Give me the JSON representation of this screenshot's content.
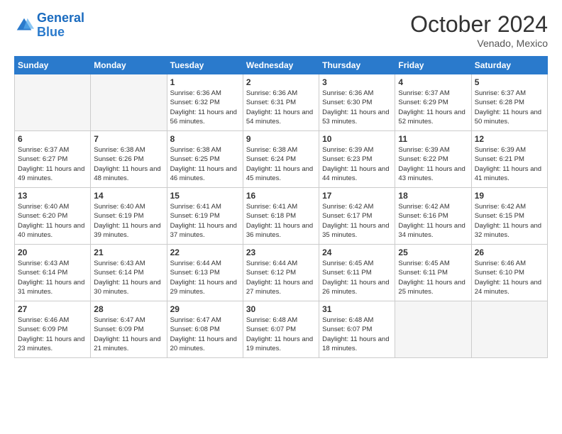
{
  "logo": {
    "line1": "General",
    "line2": "Blue"
  },
  "title": "October 2024",
  "location": "Venado, Mexico",
  "days_of_week": [
    "Sunday",
    "Monday",
    "Tuesday",
    "Wednesday",
    "Thursday",
    "Friday",
    "Saturday"
  ],
  "weeks": [
    [
      {
        "num": "",
        "sunrise": "",
        "sunset": "",
        "daylight": "",
        "empty": true
      },
      {
        "num": "",
        "sunrise": "",
        "sunset": "",
        "daylight": "",
        "empty": true
      },
      {
        "num": "1",
        "sunrise": "Sunrise: 6:36 AM",
        "sunset": "Sunset: 6:32 PM",
        "daylight": "Daylight: 11 hours and 56 minutes.",
        "empty": false
      },
      {
        "num": "2",
        "sunrise": "Sunrise: 6:36 AM",
        "sunset": "Sunset: 6:31 PM",
        "daylight": "Daylight: 11 hours and 54 minutes.",
        "empty": false
      },
      {
        "num": "3",
        "sunrise": "Sunrise: 6:36 AM",
        "sunset": "Sunset: 6:30 PM",
        "daylight": "Daylight: 11 hours and 53 minutes.",
        "empty": false
      },
      {
        "num": "4",
        "sunrise": "Sunrise: 6:37 AM",
        "sunset": "Sunset: 6:29 PM",
        "daylight": "Daylight: 11 hours and 52 minutes.",
        "empty": false
      },
      {
        "num": "5",
        "sunrise": "Sunrise: 6:37 AM",
        "sunset": "Sunset: 6:28 PM",
        "daylight": "Daylight: 11 hours and 50 minutes.",
        "empty": false
      }
    ],
    [
      {
        "num": "6",
        "sunrise": "Sunrise: 6:37 AM",
        "sunset": "Sunset: 6:27 PM",
        "daylight": "Daylight: 11 hours and 49 minutes.",
        "empty": false
      },
      {
        "num": "7",
        "sunrise": "Sunrise: 6:38 AM",
        "sunset": "Sunset: 6:26 PM",
        "daylight": "Daylight: 11 hours and 48 minutes.",
        "empty": false
      },
      {
        "num": "8",
        "sunrise": "Sunrise: 6:38 AM",
        "sunset": "Sunset: 6:25 PM",
        "daylight": "Daylight: 11 hours and 46 minutes.",
        "empty": false
      },
      {
        "num": "9",
        "sunrise": "Sunrise: 6:38 AM",
        "sunset": "Sunset: 6:24 PM",
        "daylight": "Daylight: 11 hours and 45 minutes.",
        "empty": false
      },
      {
        "num": "10",
        "sunrise": "Sunrise: 6:39 AM",
        "sunset": "Sunset: 6:23 PM",
        "daylight": "Daylight: 11 hours and 44 minutes.",
        "empty": false
      },
      {
        "num": "11",
        "sunrise": "Sunrise: 6:39 AM",
        "sunset": "Sunset: 6:22 PM",
        "daylight": "Daylight: 11 hours and 43 minutes.",
        "empty": false
      },
      {
        "num": "12",
        "sunrise": "Sunrise: 6:39 AM",
        "sunset": "Sunset: 6:21 PM",
        "daylight": "Daylight: 11 hours and 41 minutes.",
        "empty": false
      }
    ],
    [
      {
        "num": "13",
        "sunrise": "Sunrise: 6:40 AM",
        "sunset": "Sunset: 6:20 PM",
        "daylight": "Daylight: 11 hours and 40 minutes.",
        "empty": false
      },
      {
        "num": "14",
        "sunrise": "Sunrise: 6:40 AM",
        "sunset": "Sunset: 6:19 PM",
        "daylight": "Daylight: 11 hours and 39 minutes.",
        "empty": false
      },
      {
        "num": "15",
        "sunrise": "Sunrise: 6:41 AM",
        "sunset": "Sunset: 6:19 PM",
        "daylight": "Daylight: 11 hours and 37 minutes.",
        "empty": false
      },
      {
        "num": "16",
        "sunrise": "Sunrise: 6:41 AM",
        "sunset": "Sunset: 6:18 PM",
        "daylight": "Daylight: 11 hours and 36 minutes.",
        "empty": false
      },
      {
        "num": "17",
        "sunrise": "Sunrise: 6:42 AM",
        "sunset": "Sunset: 6:17 PM",
        "daylight": "Daylight: 11 hours and 35 minutes.",
        "empty": false
      },
      {
        "num": "18",
        "sunrise": "Sunrise: 6:42 AM",
        "sunset": "Sunset: 6:16 PM",
        "daylight": "Daylight: 11 hours and 34 minutes.",
        "empty": false
      },
      {
        "num": "19",
        "sunrise": "Sunrise: 6:42 AM",
        "sunset": "Sunset: 6:15 PM",
        "daylight": "Daylight: 11 hours and 32 minutes.",
        "empty": false
      }
    ],
    [
      {
        "num": "20",
        "sunrise": "Sunrise: 6:43 AM",
        "sunset": "Sunset: 6:14 PM",
        "daylight": "Daylight: 11 hours and 31 minutes.",
        "empty": false
      },
      {
        "num": "21",
        "sunrise": "Sunrise: 6:43 AM",
        "sunset": "Sunset: 6:14 PM",
        "daylight": "Daylight: 11 hours and 30 minutes.",
        "empty": false
      },
      {
        "num": "22",
        "sunrise": "Sunrise: 6:44 AM",
        "sunset": "Sunset: 6:13 PM",
        "daylight": "Daylight: 11 hours and 29 minutes.",
        "empty": false
      },
      {
        "num": "23",
        "sunrise": "Sunrise: 6:44 AM",
        "sunset": "Sunset: 6:12 PM",
        "daylight": "Daylight: 11 hours and 27 minutes.",
        "empty": false
      },
      {
        "num": "24",
        "sunrise": "Sunrise: 6:45 AM",
        "sunset": "Sunset: 6:11 PM",
        "daylight": "Daylight: 11 hours and 26 minutes.",
        "empty": false
      },
      {
        "num": "25",
        "sunrise": "Sunrise: 6:45 AM",
        "sunset": "Sunset: 6:11 PM",
        "daylight": "Daylight: 11 hours and 25 minutes.",
        "empty": false
      },
      {
        "num": "26",
        "sunrise": "Sunrise: 6:46 AM",
        "sunset": "Sunset: 6:10 PM",
        "daylight": "Daylight: 11 hours and 24 minutes.",
        "empty": false
      }
    ],
    [
      {
        "num": "27",
        "sunrise": "Sunrise: 6:46 AM",
        "sunset": "Sunset: 6:09 PM",
        "daylight": "Daylight: 11 hours and 23 minutes.",
        "empty": false
      },
      {
        "num": "28",
        "sunrise": "Sunrise: 6:47 AM",
        "sunset": "Sunset: 6:09 PM",
        "daylight": "Daylight: 11 hours and 21 minutes.",
        "empty": false
      },
      {
        "num": "29",
        "sunrise": "Sunrise: 6:47 AM",
        "sunset": "Sunset: 6:08 PM",
        "daylight": "Daylight: 11 hours and 20 minutes.",
        "empty": false
      },
      {
        "num": "30",
        "sunrise": "Sunrise: 6:48 AM",
        "sunset": "Sunset: 6:07 PM",
        "daylight": "Daylight: 11 hours and 19 minutes.",
        "empty": false
      },
      {
        "num": "31",
        "sunrise": "Sunrise: 6:48 AM",
        "sunset": "Sunset: 6:07 PM",
        "daylight": "Daylight: 11 hours and 18 minutes.",
        "empty": false
      },
      {
        "num": "",
        "sunrise": "",
        "sunset": "",
        "daylight": "",
        "empty": true
      },
      {
        "num": "",
        "sunrise": "",
        "sunset": "",
        "daylight": "",
        "empty": true
      }
    ]
  ]
}
